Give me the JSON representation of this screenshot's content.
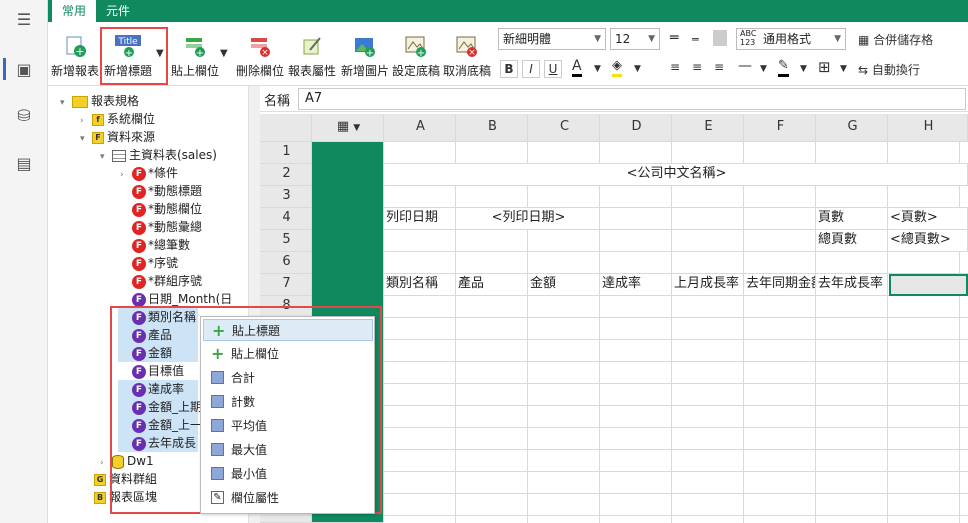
{
  "tabs": {
    "common": "常用",
    "components": "元件"
  },
  "ribbon": {
    "new_report": "新增報表",
    "new_title": "新增標題",
    "title_icon_text": "Title",
    "paste_field": "貼上欄位",
    "delete_field": "刪除欄位",
    "report_props": "報表屬性",
    "new_image": "新增圖片",
    "set_background": "設定底稿",
    "cancel_background": "取消底稿",
    "font_name": "新細明體",
    "font_size": "12",
    "format": "通用格式",
    "merge_cells": "合併儲存格",
    "wrap_text": "自動換行",
    "bold": "B",
    "italic": "I",
    "underline": "U",
    "font_color_label": "A"
  },
  "tree": {
    "root": "報表規格",
    "system_fields": "系統欄位",
    "data_source": "資料來源",
    "master": "主資料表(sales)",
    "items": [
      "*條件",
      "*動態標題",
      "*動態欄位",
      "*動態彙總",
      "*總筆數",
      "*序號",
      "*群組序號",
      "日期_Month(日"
    ],
    "selected": [
      "類別名稱",
      "產品",
      "金額",
      "目標值",
      "達成率",
      "金額_上期",
      "金額_上一",
      "去年成長"
    ],
    "dw1": "Dw1",
    "data_group": "資料群組",
    "report_section": "報表區塊"
  },
  "namebox": {
    "label": "名稱",
    "value": "A7"
  },
  "grid": {
    "cols": [
      "A",
      "B",
      "C",
      "D",
      "E",
      "F",
      "G",
      "H"
    ],
    "rows": [
      "1",
      "2",
      "3",
      "4",
      "5",
      "6",
      "7",
      "8"
    ],
    "company": "<公司中文名稱>",
    "print_date_label": "列印日期",
    "print_date_value": "<列印日期>",
    "page_label": "頁數",
    "page_value": "<頁數>",
    "total_pages_label": "總頁數",
    "total_pages_value": "<總頁數>",
    "row7": [
      "類別名稱",
      "產品",
      "金額",
      "達成率",
      "上月成長率",
      "去年同期金額",
      "去年成長率"
    ]
  },
  "context_menu": [
    "貼上標題",
    "貼上欄位",
    "合計",
    "計數",
    "平均值",
    "最大值",
    "最小值",
    "欄位屬性"
  ],
  "colors": {
    "accent": "#0f8a5f",
    "highlight_box": "#e64747"
  }
}
